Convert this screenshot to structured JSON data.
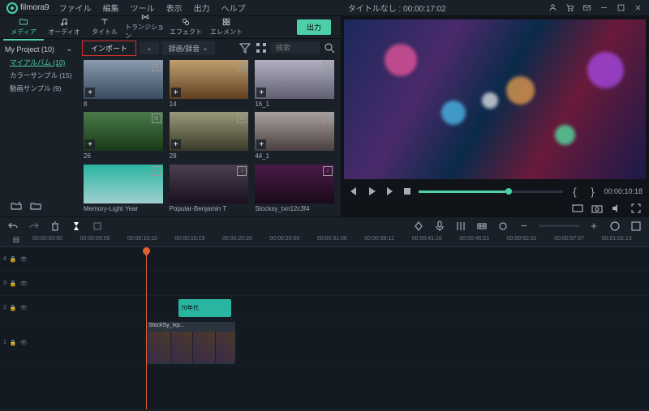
{
  "topbar": {
    "logo": "filmora9",
    "menu": [
      "ファイル",
      "編集",
      "ツール",
      "表示",
      "出力",
      "ヘルプ"
    ],
    "title": "タイトルなし : 00:00:17:02"
  },
  "tabs": [
    {
      "id": "media",
      "label": "メディア"
    },
    {
      "id": "audio",
      "label": "オーディオ"
    },
    {
      "id": "title",
      "label": "タイトル"
    },
    {
      "id": "transition",
      "label": "トランジション"
    },
    {
      "id": "effect",
      "label": "エフェクト"
    },
    {
      "id": "element",
      "label": "エレメント"
    }
  ],
  "export_label": "出力",
  "sidebar": {
    "project": "My Project (10)",
    "album": "マイアルバム (10)",
    "folders": [
      "カラーサンプル (15)",
      "動画サンプル (9)"
    ]
  },
  "mediabar": {
    "import": "インポート",
    "record": "録画/録音",
    "search_placeholder": "検索"
  },
  "clips": [
    {
      "name": "8"
    },
    {
      "name": "14"
    },
    {
      "name": "16_1"
    },
    {
      "name": "26"
    },
    {
      "name": "29"
    },
    {
      "name": "44_1"
    },
    {
      "name": "Memory-Light Year"
    },
    {
      "name": "Popular-Benjamin T"
    },
    {
      "name": "Stocksy_txn12c3f4"
    }
  ],
  "preview": {
    "time": "00:00:10:18"
  },
  "ruler": [
    "00:00:00:00",
    "00:00:05:05",
    "00:00:10:10",
    "00:00:15:15",
    "00:00:20:20",
    "00:00:26:00",
    "00:00:31:06",
    "00:00:36:11",
    "00:00:41:16",
    "00:00:46:21",
    "00:00:52:01",
    "00:00:57:07",
    "00:01:02:13"
  ],
  "trackheads": [
    "4",
    "3",
    "2",
    "1"
  ],
  "timeline_clips": {
    "title_clip": "70年代"
  }
}
